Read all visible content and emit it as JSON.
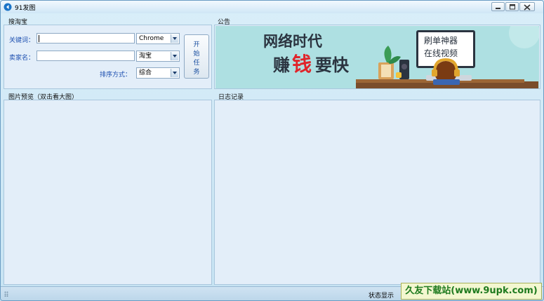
{
  "window": {
    "title": "91发图"
  },
  "search_panel": {
    "title": "搜淘宝",
    "keyword_label": "关键词：",
    "keyword_value": "",
    "browser_select": "Chrome",
    "seller_label": "卖家名：",
    "seller_value": "",
    "platform_select": "淘宝",
    "sort_label": "排序方式：",
    "sort_select": "综合",
    "start_button": [
      "开",
      "始",
      "任",
      "务"
    ]
  },
  "notice_panel": {
    "title": "公告",
    "banner_headline_1": "网络时代",
    "banner_headline_2a": "赚",
    "banner_headline_2b": "钱",
    "banner_headline_2c": "要快",
    "board_line_1": "刷单神器",
    "board_line_2": "在线视频"
  },
  "preview_panel": {
    "title": "图片预览（双击看大图）"
  },
  "log_panel": {
    "title": "日志记录"
  },
  "statusbar": {
    "text": "状态显示"
  },
  "watermark": {
    "text": "久友下载站(www.9upk.com)"
  },
  "colors": {
    "accent": "#1c4fb0",
    "banner_bg": "#aee0e2",
    "highlight": "#e0242a"
  }
}
